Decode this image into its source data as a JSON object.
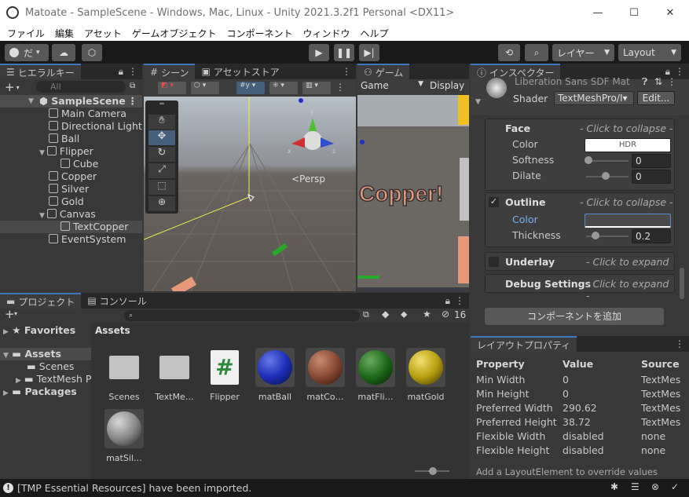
{
  "window": {
    "title": "Matoate - SampleScene - Windows, Mac, Linux - Unity 2021.3.2f1 Personal <DX11>",
    "minimize": "—",
    "maximize": "☐",
    "close": "✕"
  },
  "menu": [
    "ファイル",
    "編集",
    "アセット",
    "ゲームオブジェクト",
    "コンポーネント",
    "ウィンドウ",
    "ヘルプ"
  ],
  "toolbar": {
    "account": "だ",
    "layers_label": "レイヤー",
    "layout_label": "Layout"
  },
  "hierarchy": {
    "tab": "ヒエラルキー",
    "search_placeholder": "All",
    "scene": "SampleScene",
    "items": [
      "Main Camera",
      "Directional Light",
      "Ball",
      "Flipper",
      "Cube",
      "Copper",
      "Silver",
      "Gold",
      "Canvas",
      "TextCopper",
      "EventSystem"
    ]
  },
  "scene_view": {
    "tab": "シーン",
    "tab2": "アセットストア",
    "persp": "<Persp",
    "gizmo_x": "x",
    "gizmo_z": "z",
    "gizmo_y": "y"
  },
  "game_view": {
    "tab": "ゲーム",
    "display_select": "Game",
    "display_label": "Display",
    "game_text": "Copper!"
  },
  "inspector": {
    "tab": "インスペクター",
    "material_name": "Liberation Sans SDF Mat",
    "shader_label": "Shader",
    "shader_value": "TextMeshPro/I▾",
    "edit_button": "Edit...",
    "face": {
      "title": "Face",
      "hint": "- Click to collapse -",
      "color_label": "Color",
      "color_value": "HDR",
      "softness_label": "Softness",
      "softness_value": "0",
      "softness_level": 0,
      "dilate_label": "Dilate",
      "dilate_value": "0",
      "dilate_level": 0.5
    },
    "outline": {
      "title": "Outline",
      "hint": "- Click to collapse -",
      "color_label": "Color",
      "thickness_label": "Thickness",
      "thickness_value": "0.2",
      "thickness_level": 0.2
    },
    "underlay": {
      "title": "Underlay",
      "hint": "- Click to expand -"
    },
    "debug": {
      "title": "Debug Settings",
      "hint": "- Click to expand -"
    },
    "add_component": "コンポーネントを追加"
  },
  "layout_props": {
    "tab": "レイアウトプロパティ",
    "headers": [
      "Property",
      "Value",
      "Source"
    ],
    "rows": [
      [
        "Min Width",
        "0",
        "TextMes"
      ],
      [
        "Min Height",
        "0",
        "TextMes"
      ],
      [
        "Preferred Width",
        "290.62",
        "TextMes"
      ],
      [
        "Preferred Height",
        "38.72",
        "TextMes"
      ],
      [
        "Flexible Width",
        "disabled",
        "none"
      ],
      [
        "Flexible Height",
        "disabled",
        "none"
      ]
    ],
    "footer": "Add a LayoutElement to override values"
  },
  "project": {
    "tab": "プロジェクト",
    "tab2": "コンソール",
    "count": "16",
    "tree": {
      "favorites": "Favorites",
      "assets": "Assets",
      "scenes": "Scenes",
      "textmesh": "TextMesh P",
      "packages": "Packages"
    },
    "breadcrumb": "Assets",
    "assets": [
      {
        "name": "Scenes",
        "kind": "folder"
      },
      {
        "name": "TextMe…",
        "kind": "folder"
      },
      {
        "name": "Flipper",
        "kind": "script"
      },
      {
        "name": "matBall",
        "kind": "mat",
        "color": "#1e2fb8"
      },
      {
        "name": "matCo…",
        "kind": "mat",
        "color": "#8a4a35"
      },
      {
        "name": "matFli…",
        "kind": "mat",
        "color": "#1e6a1a"
      },
      {
        "name": "matGold",
        "kind": "mat",
        "color": "#b8a010"
      },
      {
        "name": "matSil…",
        "kind": "mat",
        "color": "#8a8a8a"
      }
    ]
  },
  "status": {
    "message": "[TMP Essential Resources] have been imported."
  }
}
